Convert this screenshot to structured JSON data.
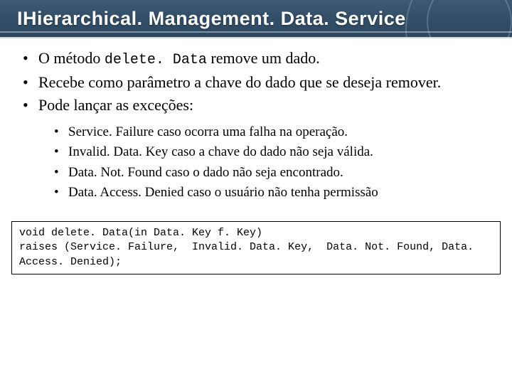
{
  "title": "IHierarchical. Management. Data. Service",
  "bullets": {
    "b1_pre": "O método ",
    "b1_code": "delete. Data",
    "b1_post": " remove um dado.",
    "b2": "Recebe como parâmetro a chave do dado que se deseja remover.",
    "b3": "Pode lançar as exceções:"
  },
  "exceptions": [
    "Service. Failure caso ocorra uma falha na operação.",
    "Invalid. Data. Key caso a chave do dado não seja válida.",
    "Data. Not. Found caso o dado não seja encontrado.",
    "Data. Access. Denied caso o usuário não tenha permissão"
  ],
  "code": {
    "line1": "void delete. Data(in Data. Key f. Key)",
    "line2": "raises (Service. Failure,  Invalid. Data. Key,  Data. Not. Found, Data. Access. Denied);"
  }
}
